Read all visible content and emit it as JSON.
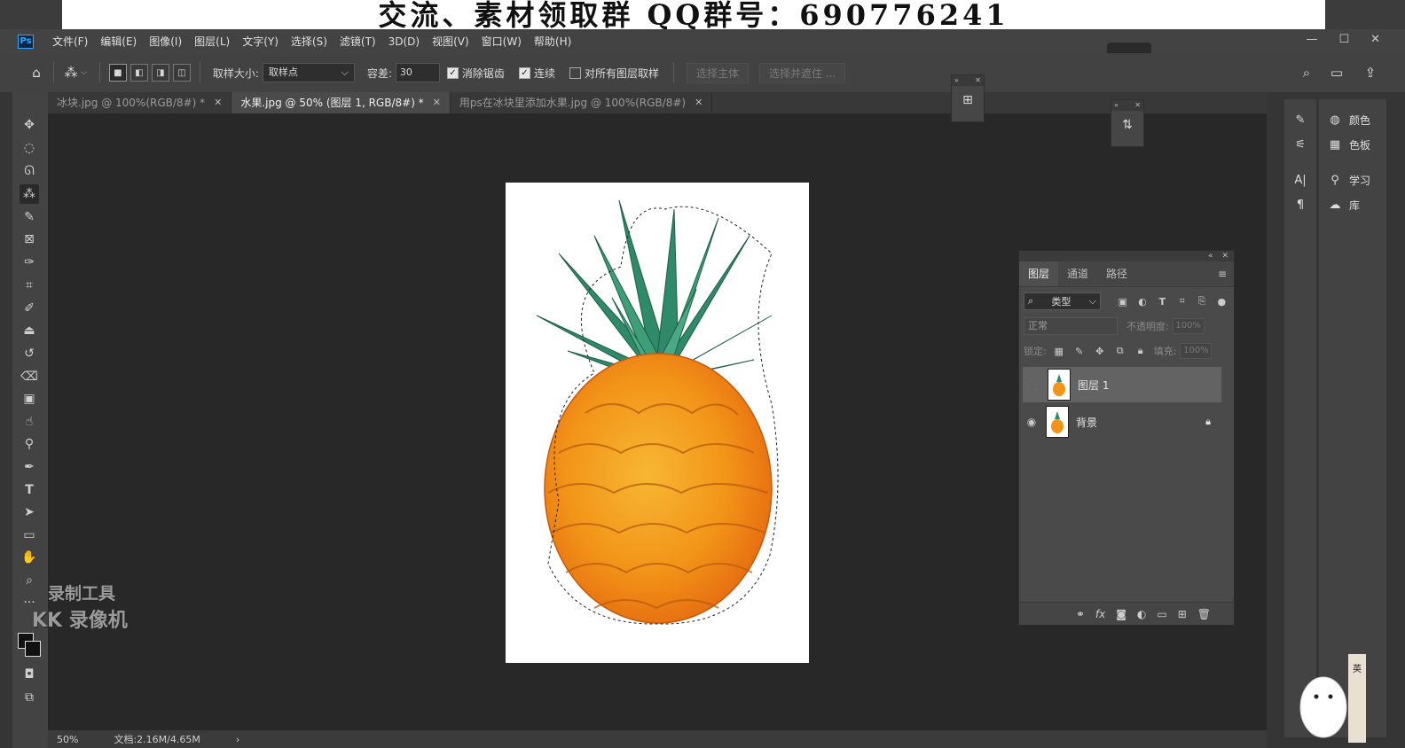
{
  "banner": {
    "text": "交流、素材领取群  QQ群号：690776241"
  },
  "app": {
    "logo": "Ps"
  },
  "menu": [
    "文件(F)",
    "编辑(E)",
    "图像(I)",
    "图层(L)",
    "文字(Y)",
    "选择(S)",
    "滤镜(T)",
    "3D(D)",
    "视图(V)",
    "窗口(W)",
    "帮助(H)"
  ],
  "window_controls": {
    "minimize": "—",
    "maximize": "☐",
    "close": "✕"
  },
  "options": {
    "sample_size_label": "取样大小:",
    "sample_size_value": "取样点",
    "tolerance_label": "容差:",
    "tolerance_value": "30",
    "antialias_label": "消除锯齿",
    "antialias_checked": true,
    "contiguous_label": "连续",
    "contiguous_checked": true,
    "sample_all_label": "对所有图层取样",
    "sample_all_checked": false,
    "select_subject": "选择主体",
    "select_mask": "选择并遮住 ..."
  },
  "tabs": [
    {
      "label": "冰块.jpg @ 100%(RGB/8#) *",
      "active": false
    },
    {
      "label": "水果.jpg @ 50% (图层 1, RGB/8#) *",
      "active": true
    },
    {
      "label": "用ps在冰块里添加水果.jpg @ 100%(RGB/8#)",
      "active": false
    }
  ],
  "tools": [
    "move-icon",
    "marquee-icon",
    "lasso-icon",
    "magic-wand-icon",
    "quick-select-icon",
    "frame-icon",
    "eyedropper-icon",
    "crop-icon",
    "brush-icon",
    "stamp-icon",
    "history-brush-icon",
    "eraser-icon",
    "gradient-icon",
    "smudge-icon",
    "dodge-icon",
    "pen-icon",
    "type-icon",
    "path-select-icon",
    "rectangle-icon",
    "hand-icon",
    "zoom-icon",
    "more-icon"
  ],
  "status": {
    "zoom": "50%",
    "doc": "文档:2.16M/4.65M"
  },
  "layers_panel": {
    "tabs": [
      "图层",
      "通道",
      "路径"
    ],
    "active_tab": 0,
    "filter_label": "类型",
    "blend_mode": "正常",
    "opacity_label": "不透明度:",
    "opacity_value": "100%",
    "lock_label": "锁定:",
    "fill_label": "填充:",
    "fill_value": "100%",
    "layers": [
      {
        "name": "图层 1",
        "visible": false,
        "selected": true,
        "locked": false
      },
      {
        "name": "背景",
        "visible": true,
        "selected": false,
        "locked": true
      }
    ]
  },
  "right_dock": {
    "items": [
      {
        "label": "颜色",
        "icon": "color-icon"
      },
      {
        "label": "色板",
        "icon": "swatches-icon"
      },
      {
        "label": "学习",
        "icon": "learn-icon"
      },
      {
        "label": "库",
        "icon": "libraries-icon"
      }
    ]
  },
  "watermark": {
    "line1": "录制工具",
    "line2": "KK 录像机"
  },
  "ime": {
    "lang": "英"
  }
}
